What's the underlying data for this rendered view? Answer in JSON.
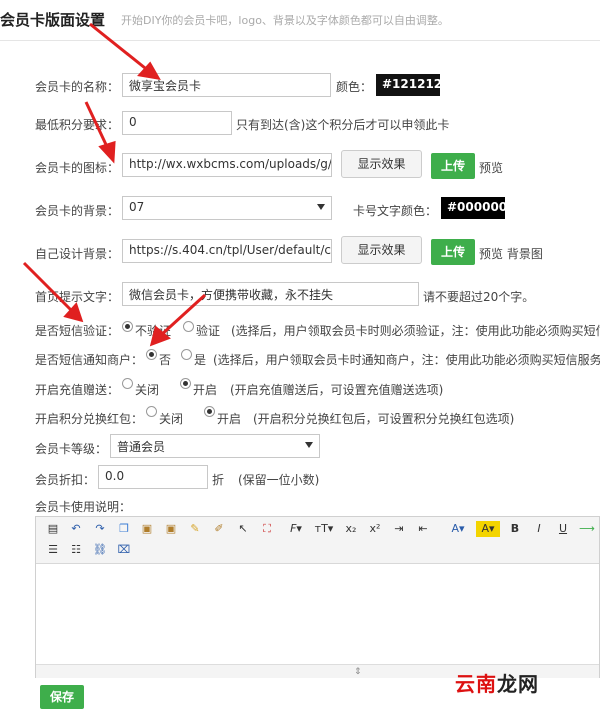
{
  "header": {
    "title": "会员卡版面设置",
    "subtitle": "开始DIY你的会员卡吧，logo、背景以及字体颜色都可以自由调整。"
  },
  "form": {
    "name_label": "会员卡的名称：",
    "name_value": "微享宝会员卡",
    "color_label": "颜色：",
    "color_value": "#121212",
    "points_label": "最低积分要求：",
    "points_value": "0",
    "points_hint": "只有到达(含)这个积分后才可以申领此卡",
    "icon_label": "会员卡的图标：",
    "icon_value": "http://wx.wxbcms.com/uploads/g/i",
    "show_effect": "显示效果",
    "upload": "上传",
    "preview": "预览",
    "bg_label": "会员卡的背景：",
    "bg_value": "07",
    "card_text_color_label": "卡号文字颜色：",
    "card_text_color_value": "#000000",
    "custom_bg_label": "自己设计背景：",
    "custom_bg_value": "https://s.404.cn/tpl/User/default/co",
    "show_effect2": "显示效果",
    "upload2": "上传",
    "preview_bg": "预览 背景图",
    "tip_label": "首页提示文字：",
    "tip_value": "微信会员卡，方便携带收藏，永不挂失",
    "tip_hint": "请不要超过20个字。",
    "sms_verify_label": "是否短信验证：",
    "sms_verify_opt1": "不验证",
    "sms_verify_opt2": "验证",
    "sms_verify_hint": "(选择后，用户领取会员卡时则必须验证，注：使用此功能必须购买短信",
    "sms_notify_label": "是否短信通知商户：",
    "sms_notify_opt1": "否",
    "sms_notify_opt2": "是",
    "sms_notify_hint": "(选择后，用户领取会员卡时通知商户，注：使用此功能必须购买短信服务",
    "recharge_label": "开启充值赠送：",
    "recharge_off": "关闭",
    "recharge_on": "开启",
    "recharge_hint": "(开启充值赠送后，可设置充值赠送选项)",
    "redpack_label": "开启积分兑换红包：",
    "redpack_off": "关闭",
    "redpack_on": "开启",
    "redpack_hint": "(开启积分兑换红包后，可设置积分兑换红包选项)",
    "level_label": "会员卡等级：",
    "level_value": "普通会员",
    "discount_label": "会员折扣：",
    "discount_value": "0.0",
    "discount_unit": "折",
    "discount_hint": "(保留一位小数)",
    "desc_label": "会员卡使用说明：",
    "save": "保存"
  },
  "watermark": {
    "red": "云南",
    "black": "龙网"
  }
}
